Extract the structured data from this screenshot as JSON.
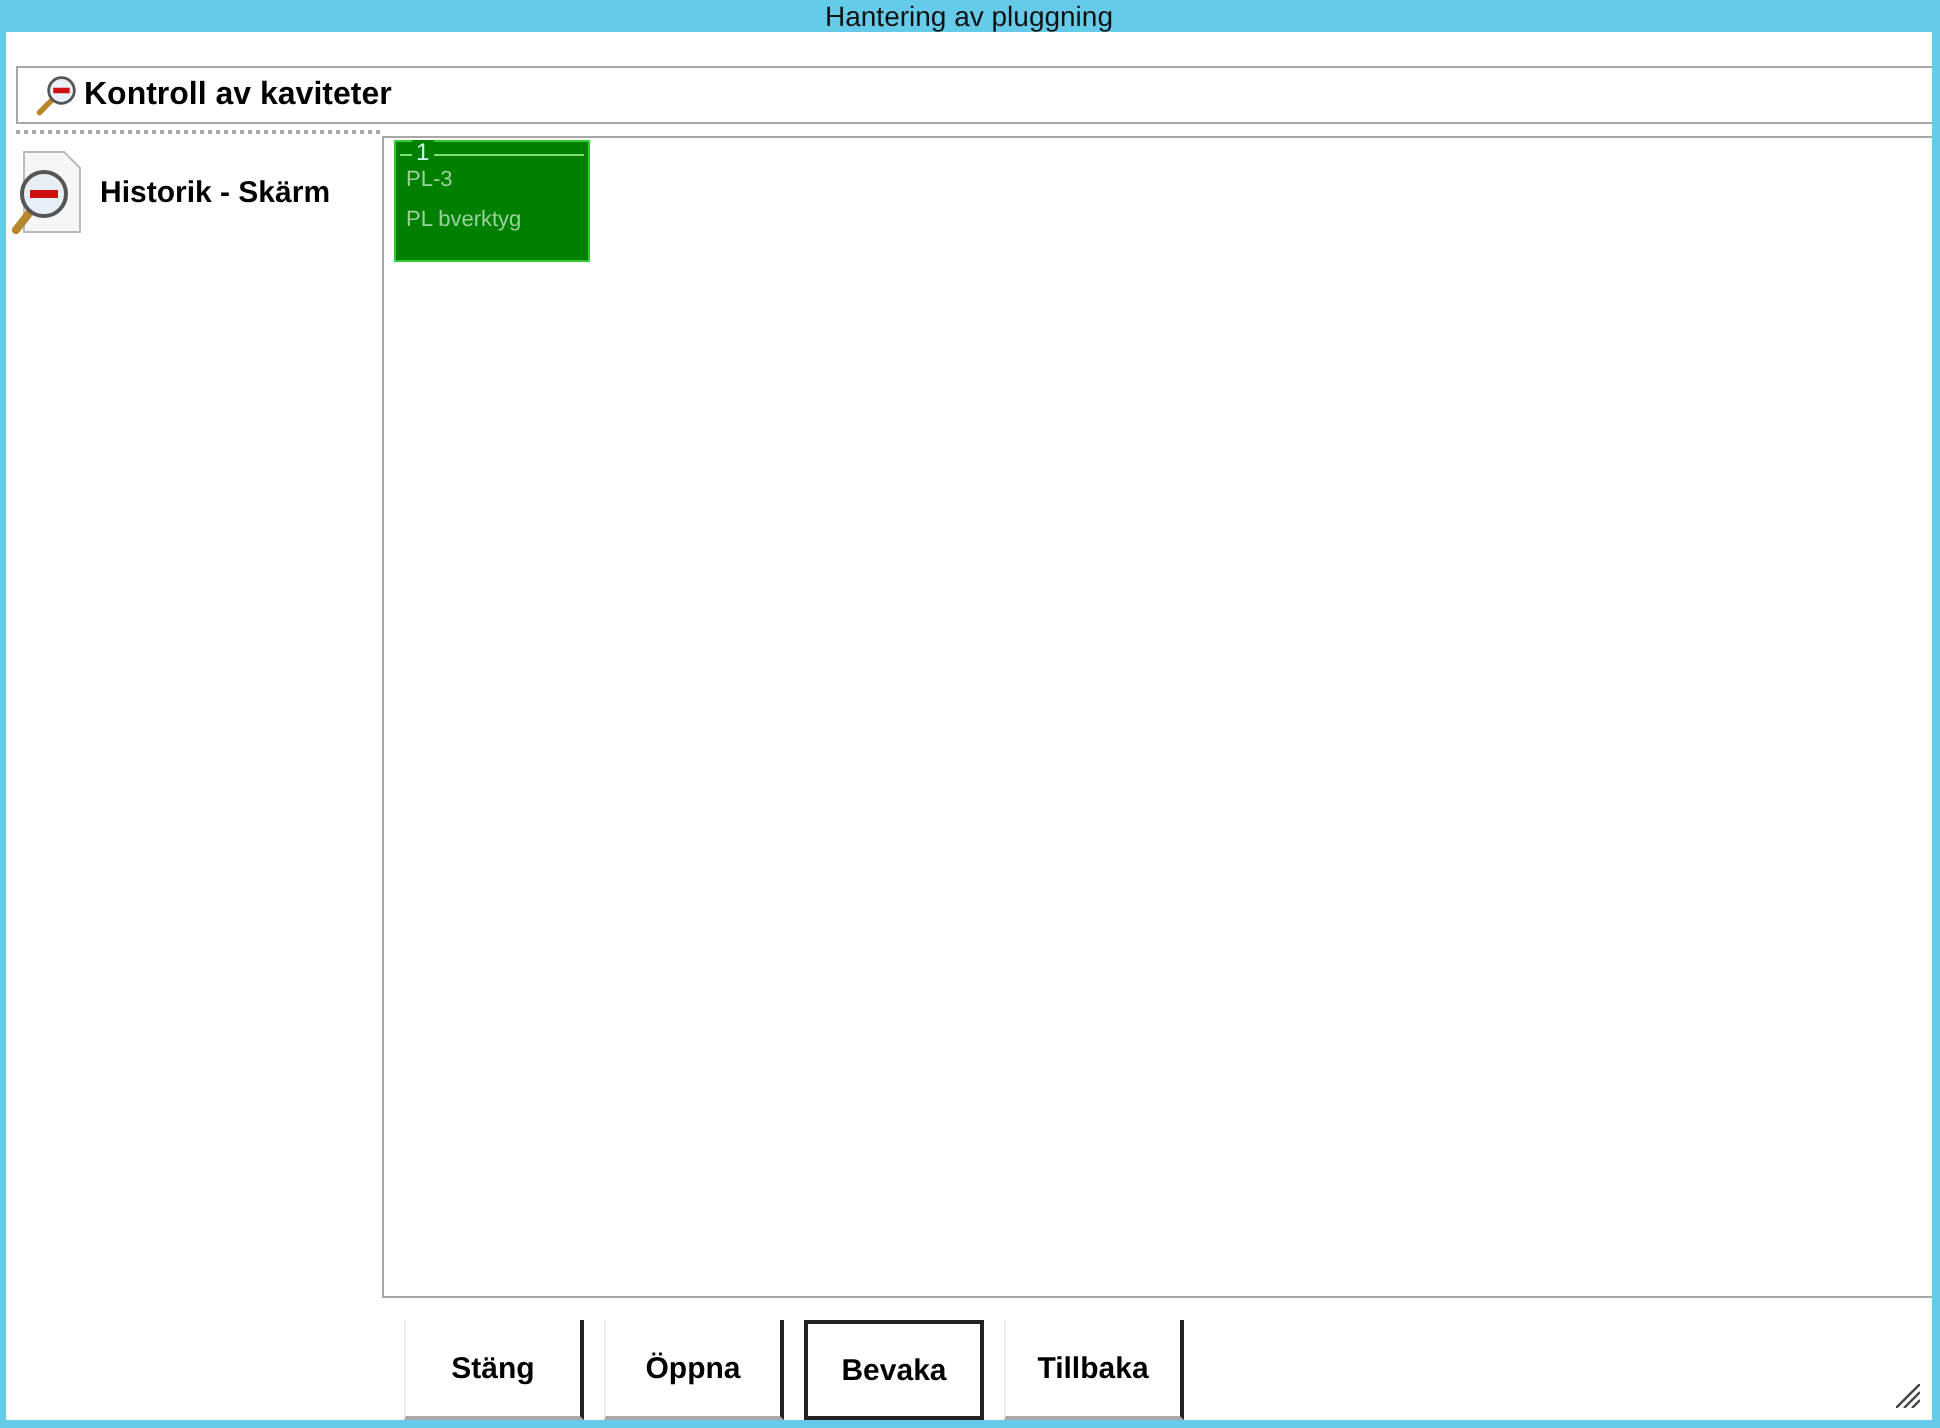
{
  "window": {
    "title": "Hantering av pluggning"
  },
  "header": {
    "label": "Kontroll av kaviteter"
  },
  "sidebar": {
    "items": [
      {
        "label": "Historik - Skärm"
      }
    ]
  },
  "tiles": [
    {
      "number": "1",
      "code": "PL-3",
      "name": "PL bverktyg"
    }
  ],
  "buttons": [
    {
      "label": "Stäng",
      "selected": false
    },
    {
      "label": "Öppna",
      "selected": false
    },
    {
      "label": "Bevaka",
      "selected": true
    },
    {
      "label": "Tillbaka",
      "selected": false
    }
  ]
}
